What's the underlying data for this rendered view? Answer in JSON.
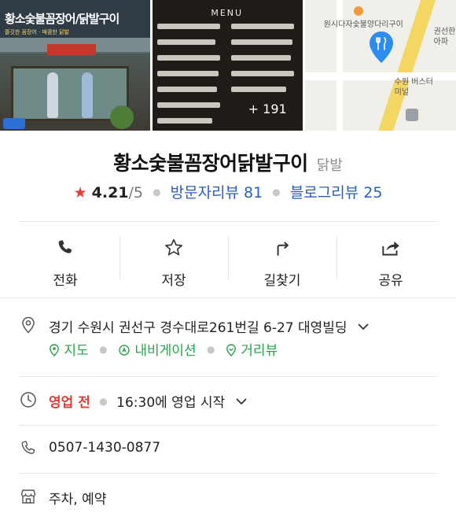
{
  "photos": {
    "store_sign": "황소숯불꼼장어/닭발구이",
    "store_sign_sub": "쫄깃한 꼼장어 · 매콤한 닭발",
    "menu_title": "MENU",
    "photo_count": "+ 191",
    "map_label_poi": "원시다자숯불양다리구이",
    "map_label_right": "권선한 아파",
    "map_label_bus": "수원 버스터미널"
  },
  "place": {
    "name": "황소숯불꼼장어닭발구이",
    "category": "닭발"
  },
  "rating": {
    "star": "★",
    "score": "4.21",
    "max": "/5",
    "visitor_reviews": "방문자리뷰 81",
    "blog_reviews": "블로그리뷰 25"
  },
  "actions": [
    {
      "label": "전화",
      "icon": "phone-icon"
    },
    {
      "label": "저장",
      "icon": "star-outline-icon"
    },
    {
      "label": "길찾기",
      "icon": "directions-icon"
    },
    {
      "label": "공유",
      "icon": "share-icon"
    }
  ],
  "address": {
    "text": "경기 수원시 권선구 경수대로261번길 6-27 대영빌딩",
    "links": [
      "지도",
      "내비게이션",
      "거리뷰"
    ]
  },
  "hours": {
    "status": "영업 전",
    "detail": "16:30에 영업 시작"
  },
  "phone": "0507-1430-0877",
  "amenities": "주차, 예약",
  "colors": {
    "accent_blue": "#2a5ebd",
    "green": "#2ba24c",
    "red": "#e23b34",
    "map_pin": "#2d8cf0"
  }
}
